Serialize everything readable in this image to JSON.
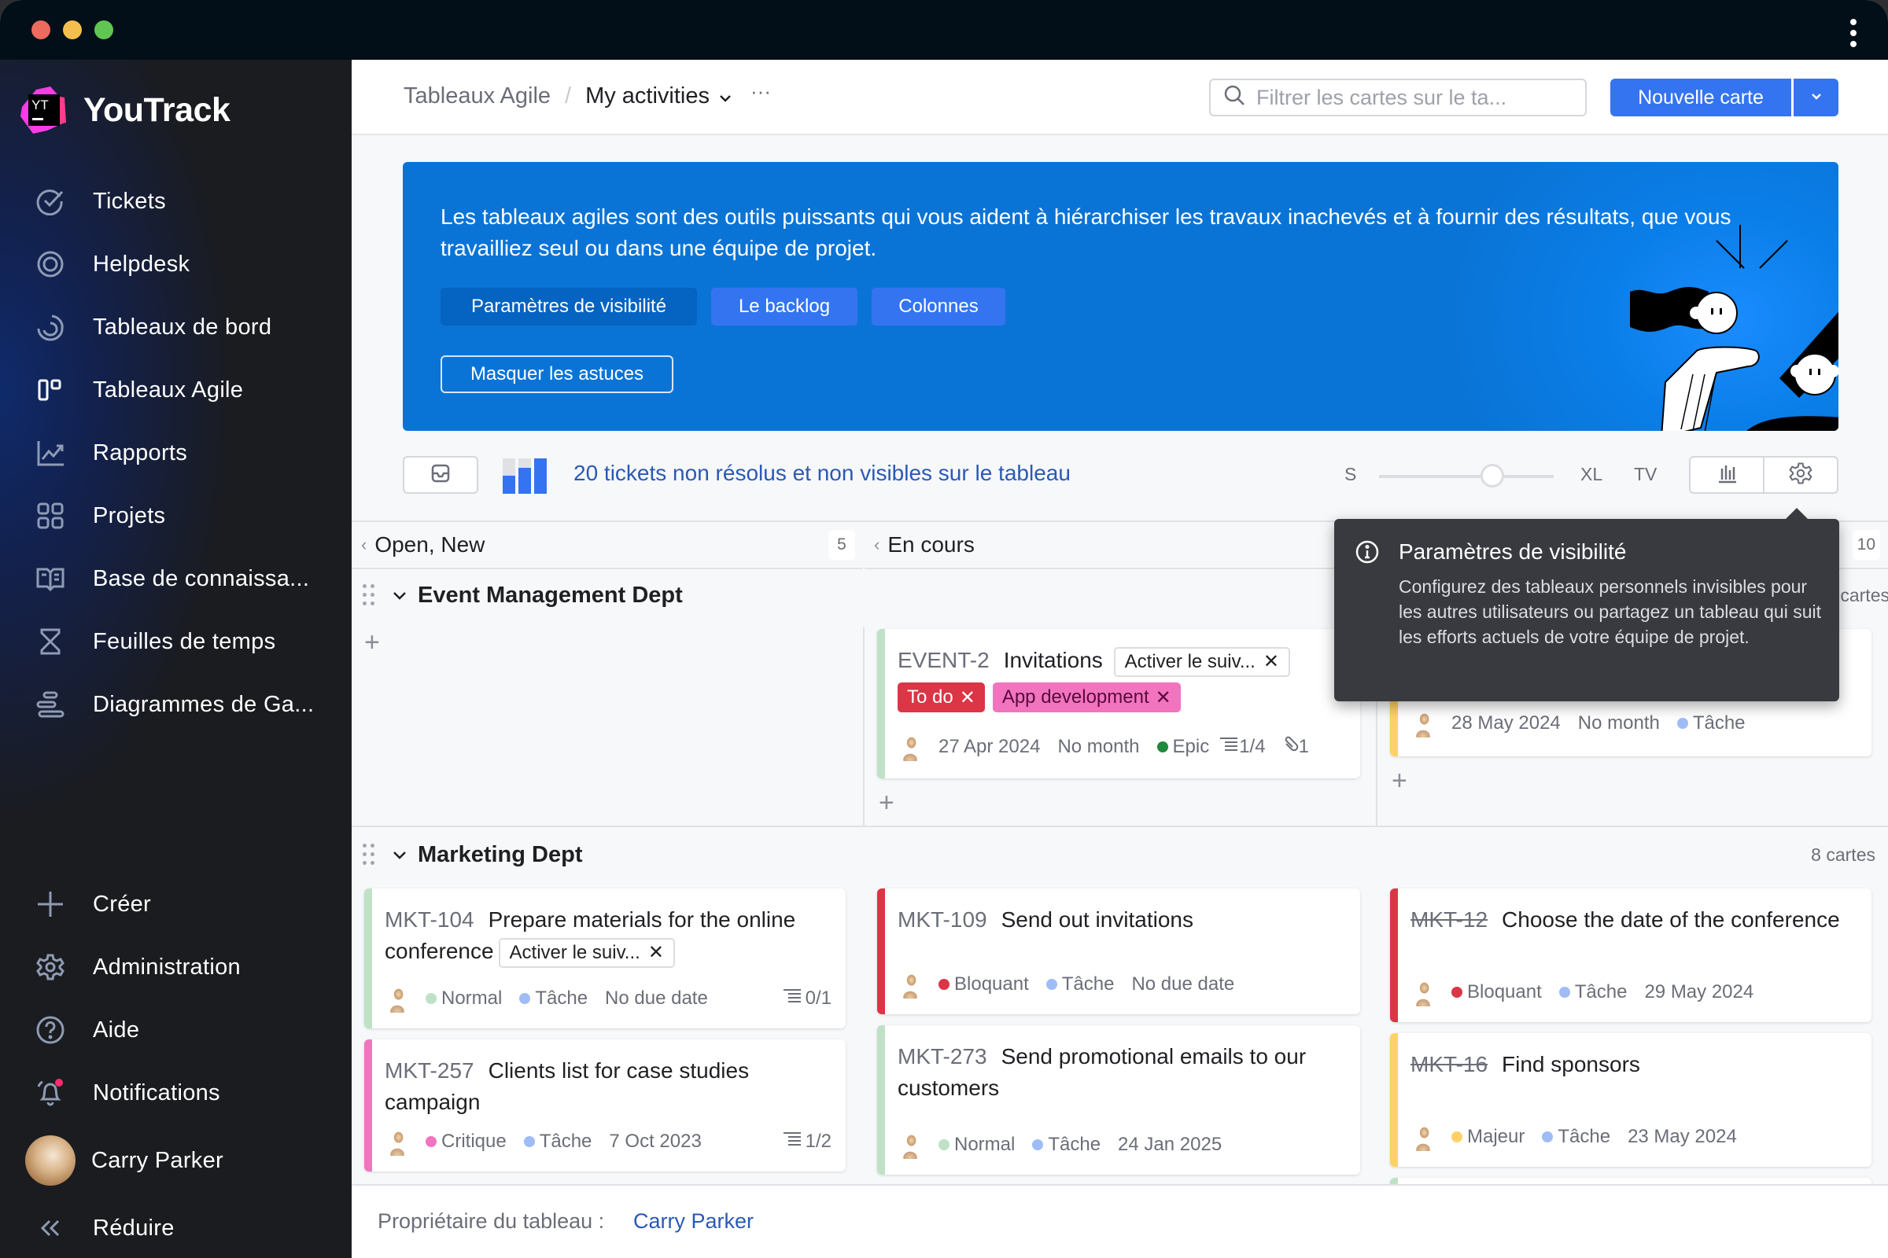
{
  "window": {
    "traffic_lights": [
      "#ec6a5e",
      "#f4bf4f",
      "#61c554"
    ],
    "menu_icon": "kebab-vertical-icon"
  },
  "app": {
    "name": "YouTrack",
    "logo_text": "YT"
  },
  "sidebar": {
    "items": [
      {
        "label": "Tickets",
        "icon": "check-circle-icon"
      },
      {
        "label": "Helpdesk",
        "icon": "lifebuoy-icon"
      },
      {
        "label": "Tableaux de bord",
        "icon": "dashboard-spiral-icon"
      },
      {
        "label": "Tableaux Agile",
        "icon": "agile-board-icon",
        "active": true
      },
      {
        "label": "Rapports",
        "icon": "chart-line-icon"
      },
      {
        "label": "Projets",
        "icon": "grid-icon"
      },
      {
        "label": "Base de connaissa...",
        "icon": "book-icon"
      },
      {
        "label": "Feuilles de temps",
        "icon": "hourglass-icon"
      },
      {
        "label": "Diagrammes de Ga...",
        "icon": "gantt-icon"
      }
    ],
    "bottom": [
      {
        "label": "Créer",
        "icon": "plus-icon"
      },
      {
        "label": "Administration",
        "icon": "gear-icon"
      },
      {
        "label": "Aide",
        "icon": "help-circle-icon"
      },
      {
        "label": "Notifications",
        "icon": "bell-icon",
        "has_badge": true
      }
    ],
    "user": {
      "name": "Carry Parker"
    },
    "collapse_label": "Réduire"
  },
  "header": {
    "breadcrumb_root": "Tableaux Agile",
    "breadcrumb_separator": "/",
    "board_name": "My activities",
    "more_label": "···",
    "search_placeholder": "Filtrer les cartes sur le ta...",
    "new_card_label": "Nouvelle carte"
  },
  "banner": {
    "text": "Les tableaux agiles sont des outils puissants qui vous aident à hiérarchiser les travaux inachevés et à fournir des résultats, que vous travailliez seul ou dans une équipe de projet.",
    "buttons": [
      "Paramètres de visibilité",
      "Le backlog",
      "Colonnes"
    ],
    "active_button": 0,
    "hide_label": "Masquer les astuces"
  },
  "toolbar": {
    "unresolved_text": "20 tickets non résolus et non visibles sur le tableau",
    "size_labels": [
      "S",
      "XL",
      "TV"
    ],
    "card_size_position": 0.65
  },
  "columns": [
    {
      "name": "Open, New",
      "count": "5"
    },
    {
      "name": "En cours",
      "count": ""
    },
    {
      "name": "",
      "count": "10"
    }
  ],
  "swimlanes": [
    {
      "title": "Event Management Dept",
      "count_label": "cartes",
      "cards": [
        {
          "id": "EVENT-2",
          "title": "Invitations",
          "column": 1,
          "tag": "Activer le suiv...",
          "pills": [
            {
              "label": "To do",
              "bg": "#dc3545",
              "fg": "#ffffff"
            },
            {
              "label": "App development",
              "bg": "#f274bf",
              "fg": "#5a0a3c"
            }
          ],
          "bar": "#bfe2c6",
          "meta": [
            "27 Apr 2024",
            "No month"
          ],
          "type": {
            "label": "Epic",
            "color": "#1e8a3c"
          },
          "subtasks": "1/4",
          "attachments": "1"
        },
        {
          "id": "",
          "title": "",
          "column": 2,
          "bar": "#ffd166",
          "meta": [
            "28 May 2024",
            "No month"
          ],
          "type": {
            "label": "Tâche",
            "color": "#9fbcf7"
          }
        }
      ]
    },
    {
      "title": "Marketing Dept",
      "count_label": "8 cartes",
      "cards": [
        {
          "id": "MKT-104",
          "title": "Prepare materials for the online conference",
          "column": 0,
          "tag": "Activer le suiv...",
          "bar": "#bfe2c6",
          "priority": {
            "label": "Normal",
            "color": "#bfe2c6"
          },
          "type": {
            "label": "Tâche",
            "color": "#9fbcf7"
          },
          "due": "No due date",
          "subtasks": "0/1"
        },
        {
          "id": "MKT-257",
          "title": "Clients list for case studies campaign",
          "column": 0,
          "bar": "#f274bf",
          "priority": {
            "label": "Critique",
            "color": "#f274bf"
          },
          "type": {
            "label": "Tâche",
            "color": "#9fbcf7"
          },
          "due": "7 Oct 2023",
          "subtasks": "1/2"
        },
        {
          "id": "MKT-109",
          "title": "Send out invitations",
          "column": 1,
          "bar": "#dc3545",
          "priority": {
            "label": "Bloquant",
            "color": "#dc3545"
          },
          "type": {
            "label": "Tâche",
            "color": "#9fbcf7"
          },
          "due": "No due date"
        },
        {
          "id": "MKT-273",
          "title": "Send promotional emails to our customers",
          "column": 1,
          "bar": "#bfe2c6",
          "priority": {
            "label": "Normal",
            "color": "#bfe2c6"
          },
          "type": {
            "label": "Tâche",
            "color": "#9fbcf7"
          },
          "due": "24 Jan 2025"
        },
        {
          "id": "MKT-12",
          "resolved": true,
          "title": "Choose the date of the conference",
          "column": 2,
          "bar": "#dc3545",
          "priority": {
            "label": "Bloquant",
            "color": "#dc3545"
          },
          "type": {
            "label": "Tâche",
            "color": "#9fbcf7"
          },
          "due": "29 May 2024"
        },
        {
          "id": "MKT-16",
          "resolved": true,
          "title": "Find sponsors",
          "column": 2,
          "bar": "#ffd166",
          "priority": {
            "label": "Majeur",
            "color": "#ffd166"
          },
          "type": {
            "label": "Tâche",
            "color": "#9fbcf7"
          },
          "due": "23 May 2024"
        }
      ]
    }
  ],
  "popover": {
    "title": "Paramètres de visibilité",
    "body": "Configurez des tableaux personnels invisibles pour les autres utilisateurs ou partagez un tableau qui suit les efforts actuels de votre équipe de projet."
  },
  "footer": {
    "owner_label": "Propriétaire du tableau :",
    "owner_name": "Carry Parker"
  },
  "colors": {
    "accent": "#3574f0",
    "banner": "#0a74d6",
    "sidebar_bg": "#1b1c1f",
    "link": "#2a59b5",
    "notification_badge": "#ff2c6d"
  }
}
